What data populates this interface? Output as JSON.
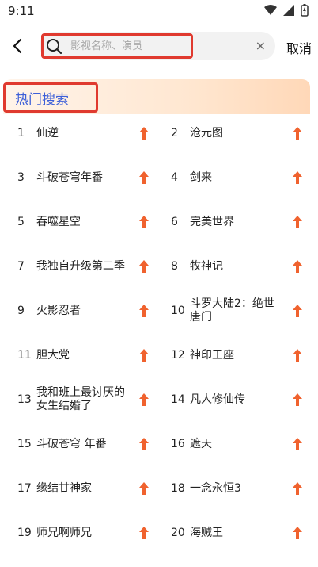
{
  "status": {
    "time": "9:11"
  },
  "search": {
    "placeholder": "影视名称、演员",
    "clear": "×",
    "cancel": "取消"
  },
  "hot": {
    "title": "热门搜索",
    "items": [
      {
        "rank": "1",
        "name": "仙逆"
      },
      {
        "rank": "2",
        "name": "沧元图"
      },
      {
        "rank": "3",
        "name": "斗破苍穹年番"
      },
      {
        "rank": "4",
        "name": "剑来"
      },
      {
        "rank": "5",
        "name": "吞噬星空"
      },
      {
        "rank": "6",
        "name": "完美世界"
      },
      {
        "rank": "7",
        "name": "我独自升级第二季"
      },
      {
        "rank": "8",
        "name": "牧神记"
      },
      {
        "rank": "9",
        "name": "火影忍者"
      },
      {
        "rank": "10",
        "name": "斗罗大陆2：绝世唐门"
      },
      {
        "rank": "11",
        "name": "胆大党"
      },
      {
        "rank": "12",
        "name": "神印王座"
      },
      {
        "rank": "13",
        "name": "我和班上最讨厌的女生结婚了"
      },
      {
        "rank": "14",
        "name": "凡人修仙传"
      },
      {
        "rank": "15",
        "name": "斗破苍穹 年番"
      },
      {
        "rank": "16",
        "name": "遮天"
      },
      {
        "rank": "17",
        "name": "缘结甘神家"
      },
      {
        "rank": "18",
        "name": "一念永恒3"
      },
      {
        "rank": "19",
        "name": "师兄啊师兄"
      },
      {
        "rank": "20",
        "name": "海贼王"
      }
    ]
  },
  "colors": {
    "accent": "#3d5fd8",
    "highlight": "#e03a2f",
    "arrow": "#f0622e"
  }
}
